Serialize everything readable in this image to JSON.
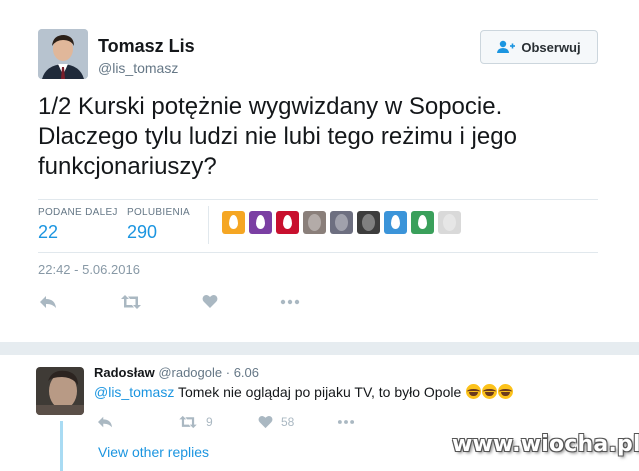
{
  "tweet": {
    "author_name": "Tomasz Lis",
    "author_handle": "@lis_tomasz",
    "follow_label": "Obserwuj",
    "text": "1/2 Kurski potężnie wygwizdany w Sopocie. Dlaczego tylu ludzi nie lubi tego reżimu i jego funkcjonariuszy?",
    "stats": {
      "retweets_label": "PODANE DALEJ",
      "retweets_value": "22",
      "likes_label": "POLUBIENIA",
      "likes_value": "290"
    },
    "likers": [
      {
        "type": "egg",
        "color": "#f5a623"
      },
      {
        "type": "egg",
        "color": "#7b3fa3"
      },
      {
        "type": "egg",
        "color": "#c8102e"
      },
      {
        "type": "photo",
        "color": "#8a7f7a"
      },
      {
        "type": "photo",
        "color": "#6d6f80"
      },
      {
        "type": "photo",
        "color": "#3d3d3d"
      },
      {
        "type": "egg",
        "color": "#3b94d9"
      },
      {
        "type": "egg",
        "color": "#3aa05b"
      },
      {
        "type": "photo",
        "color": "#d9d9d9"
      }
    ],
    "timestamp": "22:42 - 5.06.2016",
    "actions": [
      "reply-icon",
      "retweet-icon",
      "heart-icon",
      "more-icon"
    ]
  },
  "reply": {
    "name": "Radosław",
    "handle": "@radogole",
    "separator": "·",
    "time": "6.06",
    "mention": "@lis_tomasz",
    "text": " Tomek nie oglądaj po pijaku TV, to było Opole ",
    "emoji": [
      "joy-emoji",
      "joy-emoji",
      "joy-emoji"
    ],
    "retweets": "9",
    "likes": "58",
    "view_other_replies": "View other replies"
  },
  "colors": {
    "accent": "#1b95e0",
    "muted": "#657786",
    "icon": "#aab8c2",
    "thread": "#a9dbf3"
  },
  "watermark": "www.wiocha.pl"
}
